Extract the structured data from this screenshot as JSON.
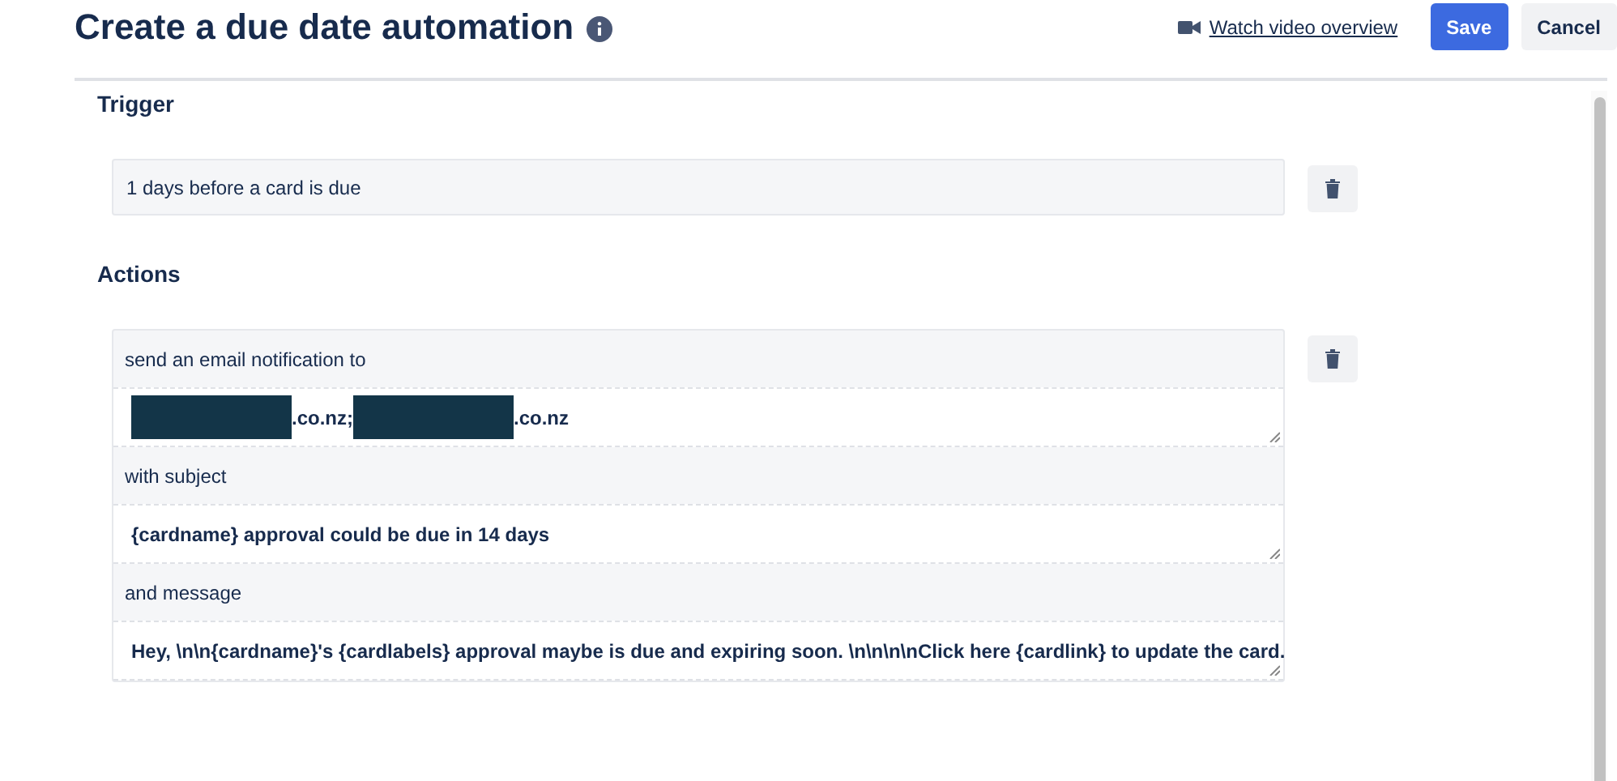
{
  "header": {
    "title": "Create a due date automation",
    "video_link": "Watch video overview",
    "buttons": [
      {
        "kind": "primary",
        "label": "Save"
      },
      {
        "kind": "secondary",
        "label": "Cancel"
      }
    ]
  },
  "trigger": {
    "heading": "Trigger",
    "text": "1 days before a card is due"
  },
  "actions": {
    "heading": "Actions",
    "rows": [
      {
        "kind": "label",
        "text": "send an email notification to"
      },
      {
        "kind": "field",
        "parts": [
          {
            "kind": "redacted"
          },
          {
            "kind": "text",
            "text": ".co.nz;"
          },
          {
            "kind": "redacted"
          },
          {
            "kind": "text",
            "text": ".co.nz"
          }
        ]
      },
      {
        "kind": "label",
        "text": "with subject"
      },
      {
        "kind": "field",
        "parts": [
          {
            "kind": "text",
            "text": "{cardname} approval could be due in 14 days"
          }
        ]
      },
      {
        "kind": "label",
        "text": "and message"
      },
      {
        "kind": "field",
        "parts": [
          {
            "kind": "text",
            "text": "Hey, \\n\\n{cardname}'s {cardlabels} approval maybe is due and expiring soon. \\n\\n\\n\\nClick here {cardlink} to update the card."
          }
        ]
      }
    ]
  }
}
